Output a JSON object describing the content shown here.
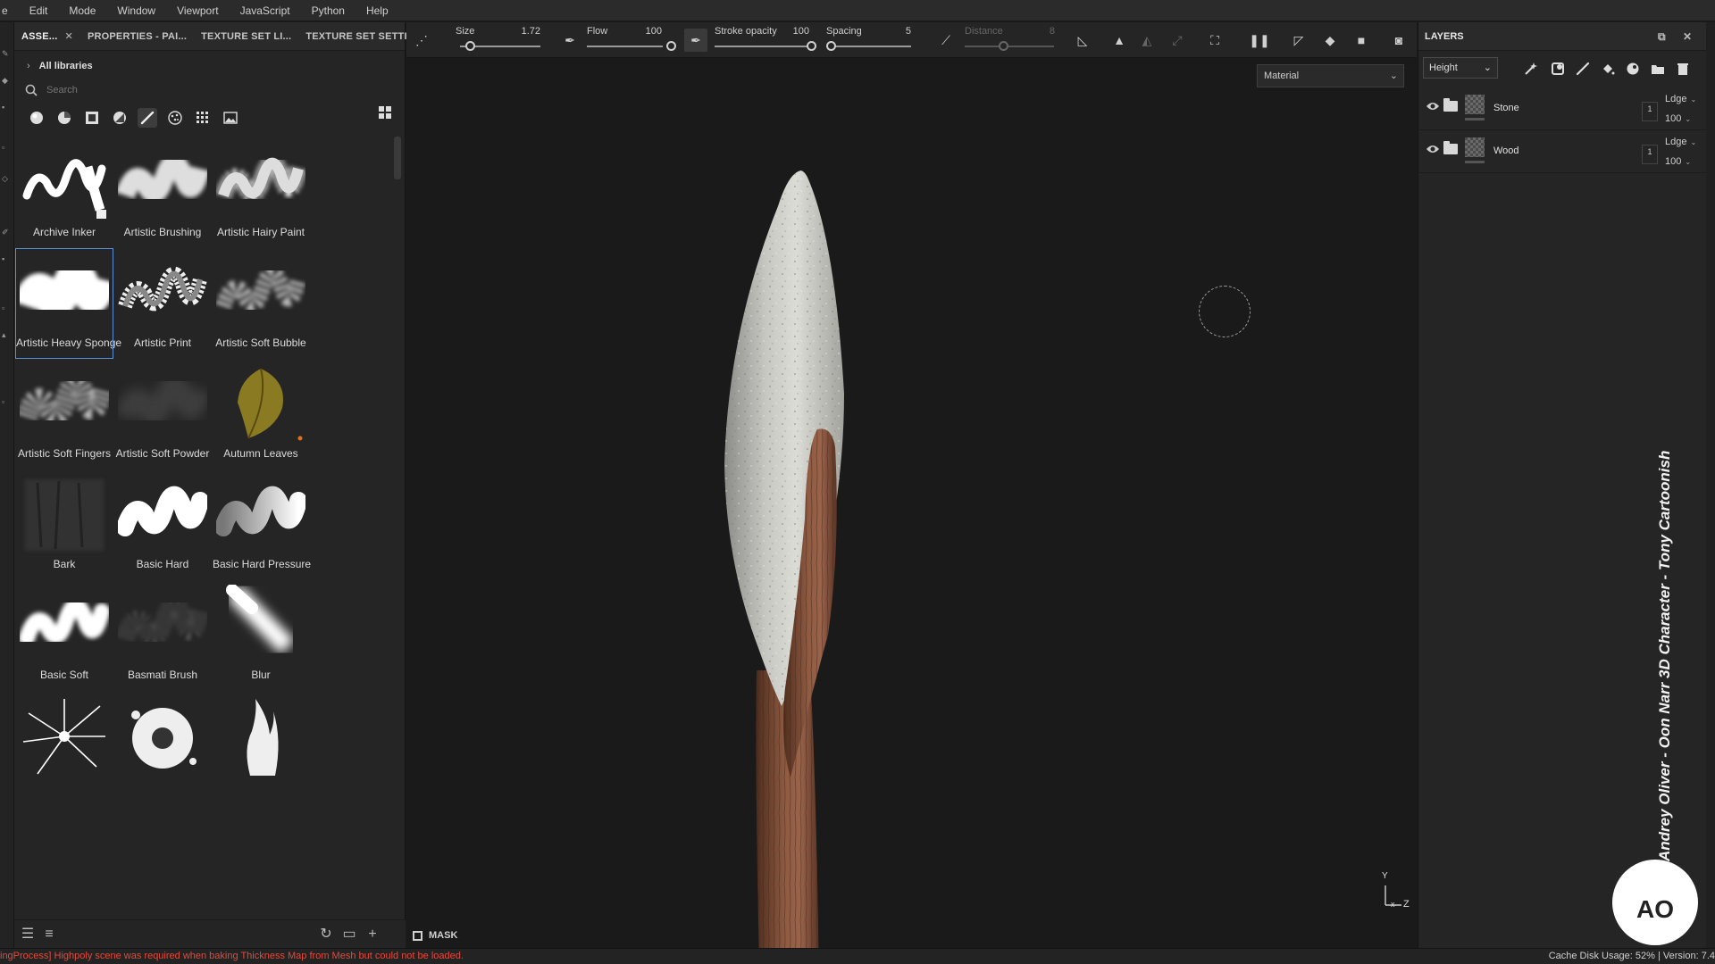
{
  "menu": [
    "e",
    "Edit",
    "Mode",
    "Window",
    "Viewport",
    "JavaScript",
    "Python",
    "Help"
  ],
  "assets_panel": {
    "tabs": [
      {
        "label": "ASSE...",
        "active": true,
        "closable": true
      },
      {
        "label": "PROPERTIES - PAI...",
        "active": false
      },
      {
        "label": "TEXTURE SET LI...",
        "active": false
      },
      {
        "label": "TEXTURE SET SETTIN...",
        "active": false
      }
    ],
    "library_label": "All libraries",
    "search_placeholder": "Search",
    "filter_icons": [
      "material-sphere-icon",
      "smart-material-icon",
      "mask-icon",
      "smart-mask-icon",
      "brush-icon",
      "particle-icon",
      "alpha-grid-icon",
      "texture-image-icon"
    ],
    "selected_filter": "brush-icon",
    "brushes": [
      {
        "name": "Archive Inker",
        "style": "ink"
      },
      {
        "name": "Artistic Brushing",
        "style": "soft-stroke"
      },
      {
        "name": "Artistic Hairy Paint",
        "style": "hairy"
      },
      {
        "name": "Artistic Heavy Sponge",
        "style": "sponge",
        "selected": true
      },
      {
        "name": "Artistic Print",
        "style": "print"
      },
      {
        "name": "Artistic Soft Bubble",
        "style": "bubble"
      },
      {
        "name": "Artistic Soft Fingers",
        "style": "fingers"
      },
      {
        "name": "Artistic Soft Powder",
        "style": "powder"
      },
      {
        "name": "Autumn Leaves",
        "style": "leaf"
      },
      {
        "name": "Bark",
        "style": "bark"
      },
      {
        "name": "Basic Hard",
        "style": "hard"
      },
      {
        "name": "Basic Hard Pressure",
        "style": "pressure"
      },
      {
        "name": "Basic Soft",
        "style": "soft"
      },
      {
        "name": "Basmati Brush",
        "style": "basmati"
      },
      {
        "name": "Blur",
        "style": "blur"
      },
      {
        "name": "",
        "style": "crack"
      },
      {
        "name": "",
        "style": "splat"
      },
      {
        "name": "",
        "style": "flame"
      }
    ]
  },
  "toolbar": {
    "size_label": "Size",
    "size_value": "1.72",
    "flow_label": "Flow",
    "flow_value": "100",
    "stroke_opacity_label": "Stroke opacity",
    "stroke_opacity_value": "100",
    "spacing_label": "Spacing",
    "spacing_value": "5",
    "distance_label": "Distance",
    "distance_value": "8"
  },
  "viewport": {
    "material_mode": "Material",
    "mask_label": "MASK",
    "axis_labels": {
      "y": "Y",
      "x": "x",
      "z": "Z"
    }
  },
  "layers_panel": {
    "title": "LAYERS",
    "channel": "Height",
    "layers": [
      {
        "name": "Stone",
        "blend": "Ldge",
        "opacity": "100",
        "number": "1"
      },
      {
        "name": "Wood",
        "blend": "Ldge",
        "opacity": "100",
        "number": "1"
      }
    ]
  },
  "watermark": "Andrey Oliver - Oon Narr 3D Character - Tony Cartoonish",
  "logo_text": "AO",
  "statusbar": {
    "error": "ingProcess] Highpoly scene was required when baking Thickness Map from Mesh but could not be loaded.",
    "cache": "Cache Disk Usage:   52%  |  Version: 7.4"
  },
  "colors": {
    "accent": "#5b8fd6",
    "error": "#e24a3a",
    "panel": "#252525",
    "viewport_bg": "#1a1a1a"
  }
}
